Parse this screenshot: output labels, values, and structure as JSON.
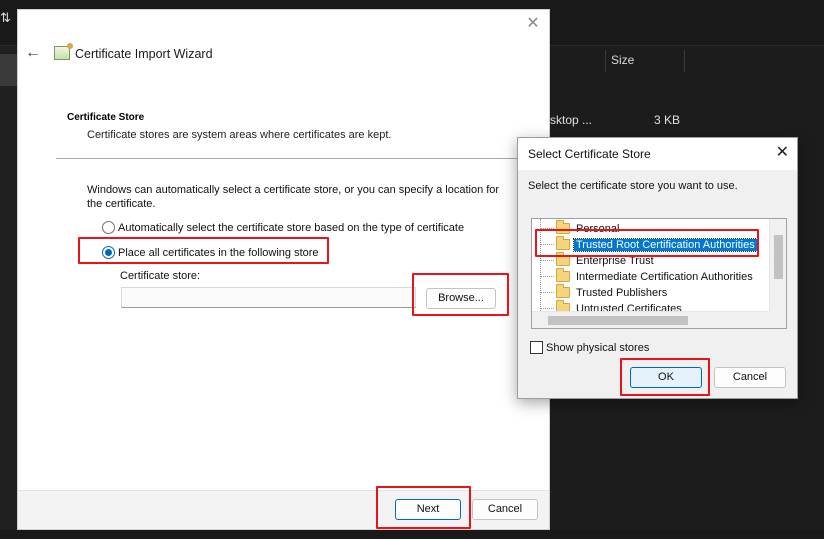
{
  "background": {
    "sort_icon": "⇅",
    "column_size_label": "Size",
    "row_name": "sktop ...",
    "row_size": "3 KB"
  },
  "wizard": {
    "title": "Certificate Import Wizard",
    "heading": "Certificate Store",
    "subheading": "Certificate stores are system areas where certificates are kept.",
    "intro": "Windows can automatically select a certificate store, or you can specify a location for the certificate.",
    "radio_auto_label": "Automatically select the certificate store based on the type of certificate",
    "radio_place_label": "Place all certificates in the following store",
    "store_label": "Certificate store:",
    "store_value": "",
    "browse_label": "Browse...",
    "next_label": "Next",
    "cancel_label": "Cancel"
  },
  "dialog": {
    "title": "Select Certificate Store",
    "prompt": "Select the certificate store you want to use.",
    "stores": [
      "Personal",
      "Trusted Root Certification Authorities",
      "Enterprise Trust",
      "Intermediate Certification Authorities",
      "Trusted Publishers",
      "Untrusted Certificates"
    ],
    "selected_store": "Trusted Root Certification Authorities",
    "show_physical_label": "Show physical stores",
    "show_physical_checked": false,
    "ok_label": "OK",
    "cancel_label": "Cancel"
  },
  "colors": {
    "highlight": "#e8141c",
    "accent": "#0067c0",
    "selection": "#0078d7"
  }
}
